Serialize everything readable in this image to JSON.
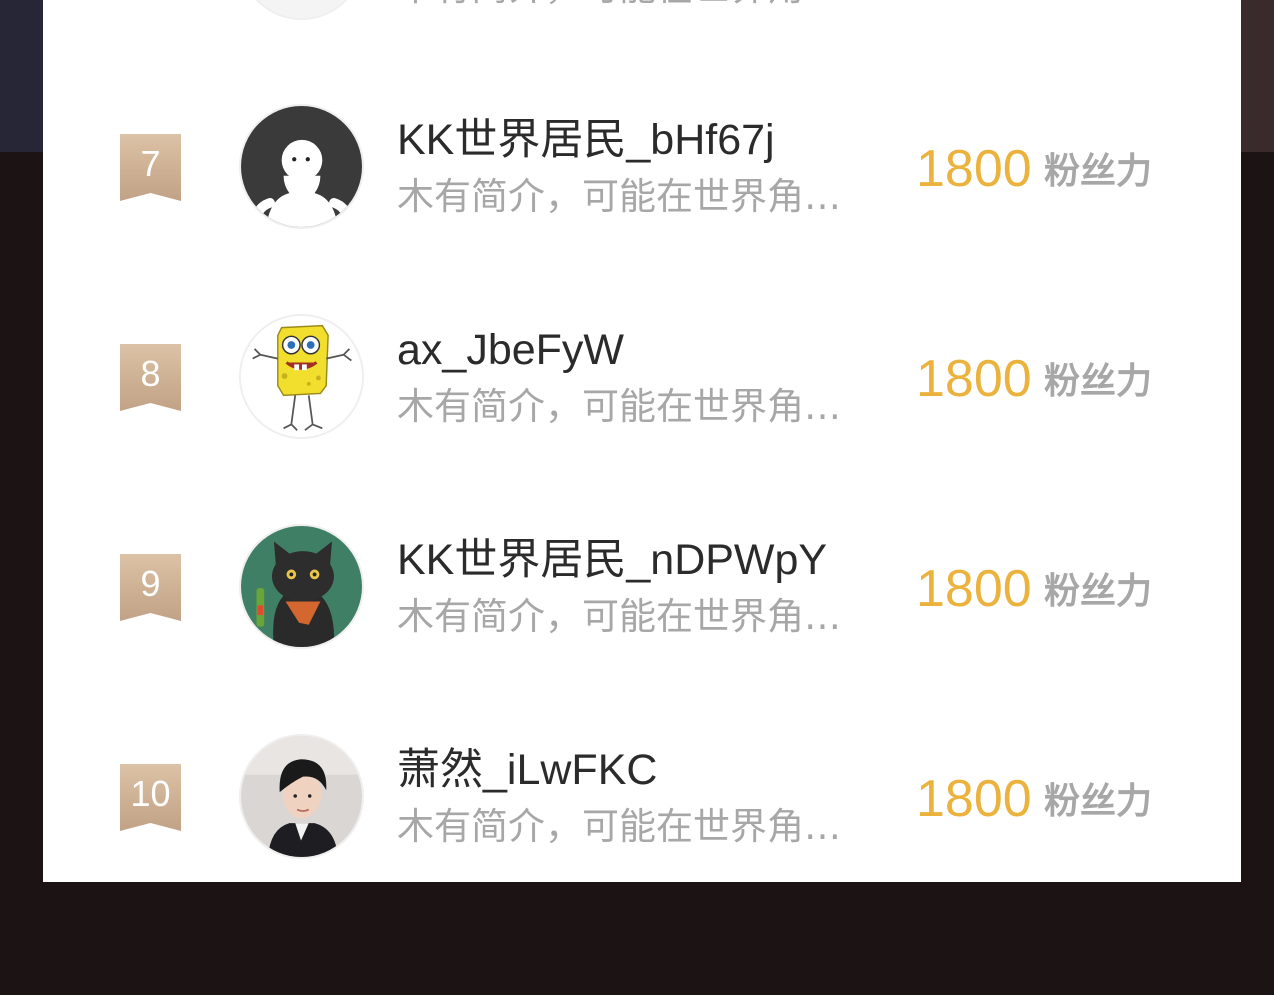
{
  "leaderboard": {
    "partial_prev": {
      "intro": "木有简介，可能在世界角…"
    },
    "rows": [
      {
        "rank": "7",
        "name": "KK世界居民_bHf67j",
        "intro": "木有简介，可能在世界角…",
        "score": "1800",
        "unit": "粉丝力",
        "avatar": "default-white-figure-avatar"
      },
      {
        "rank": "8",
        "name": "ax_JbeFyW",
        "intro": "木有简介，可能在世界角…",
        "score": "1800",
        "unit": "粉丝力",
        "avatar": "spongebob-drawing-avatar"
      },
      {
        "rank": "9",
        "name": "KK世界居民_nDPWpY",
        "intro": "木有简介，可能在世界角…",
        "score": "1800",
        "unit": "粉丝力",
        "avatar": "black-cat-cartoon-avatar"
      },
      {
        "rank": "10",
        "name": "萧然_iLwFKC",
        "intro": "木有简介，可能在世界角…",
        "score": "1800",
        "unit": "粉丝力",
        "avatar": "young-man-photo-avatar"
      }
    ]
  },
  "colors": {
    "score": "#ebb33d",
    "rank_badge": "#cdb093",
    "name": "#2b2b2b",
    "intro": "#a7a7a7"
  }
}
